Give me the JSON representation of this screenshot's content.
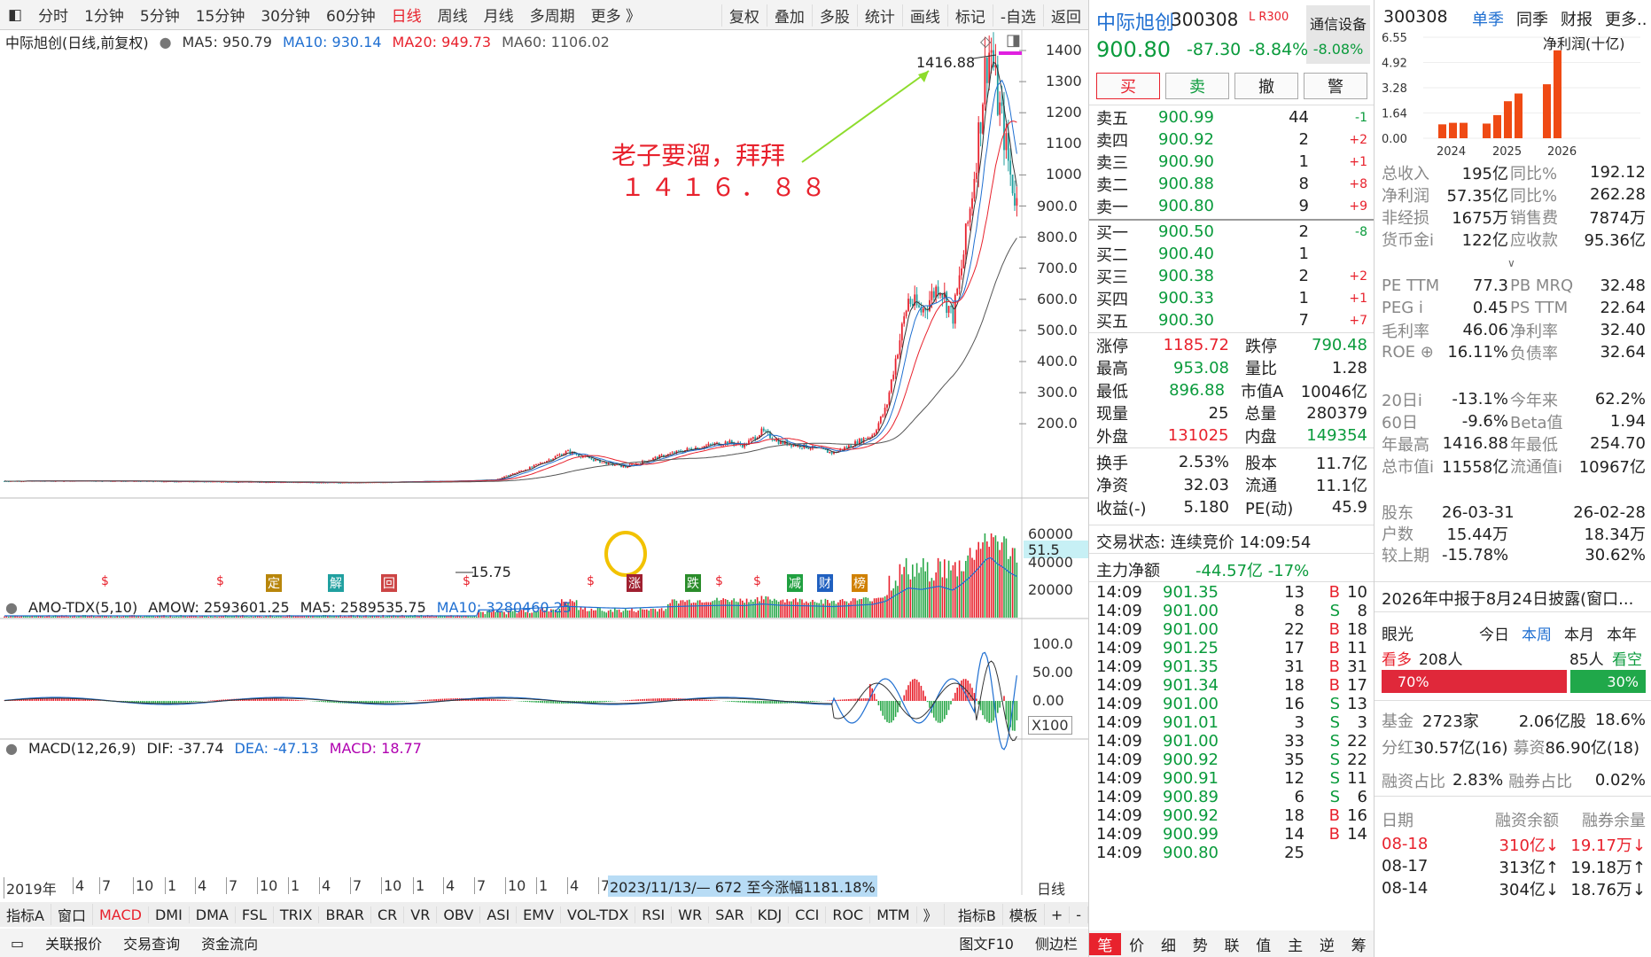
{
  "toolbar": {
    "periods": [
      "分时",
      "1分钟",
      "5分钟",
      "15分钟",
      "30分钟",
      "60分钟",
      "日线",
      "周线",
      "月线",
      "多周期",
      "更多 》"
    ],
    "active_period": "日线",
    "right": [
      "复权",
      "叠加",
      "多股",
      "统计",
      "画线",
      "标记",
      "-自选",
      "返回"
    ]
  },
  "main_info": {
    "name": "中际旭创(日线,前复权)",
    "ma5": "MA5: 950.79",
    "ma10": "MA10: 930.14",
    "ma20": "MA20: 949.73",
    "ma60": "MA60: 1106.02"
  },
  "annotation": {
    "line1": "老子要溜，拜拜",
    "line2": "１４１６．８８",
    "peak": "1416.88",
    "low": "15.75"
  },
  "price_axis": [
    "1400",
    "1300",
    "1200",
    "1100",
    "1000",
    "900.0",
    "800.0",
    "700.0",
    "600.0",
    "500.0",
    "400.0",
    "300.0",
    "200.0"
  ],
  "current_tag": "51.5",
  "vol_info": {
    "name": "AMO-TDX(5,10)",
    "amow": "AMOW: 2593601.25",
    "ma5": "MA5: 2589535.75",
    "ma10": "MA10: 3280460.25"
  },
  "vol_axis": [
    "60000",
    "40000",
    "20000"
  ],
  "vol_unit": "X100",
  "macd_info": {
    "name": "MACD(12,26,9)",
    "dif": "DIF: -37.74",
    "dea": "DEA: -47.13",
    "macd": "MACD: 18.77"
  },
  "macd_axis": [
    "100.0",
    "50.00",
    "0.00"
  ],
  "time_axis": [
    "2019年",
    "4",
    "7",
    "10",
    "1",
    "4",
    "7",
    "10",
    "1",
    "4",
    "7",
    "10",
    "1",
    "4",
    "7",
    "10",
    "1",
    "4",
    "7",
    "10",
    "1",
    "4",
    "7",
    "10",
    "1",
    "4",
    "7"
  ],
  "range_text": "2023/11/13/— 672 至今涨幅1181.18%",
  "time_unit": "日线",
  "event_marks": [
    "$",
    "$",
    "定",
    "解",
    "回",
    "$",
    "$",
    "涨",
    "跌",
    "$",
    "$",
    "减",
    "财",
    "榜"
  ],
  "indicator_tabs": [
    "指标A",
    "窗口",
    "MACD",
    "DMI",
    "DMA",
    "FSL",
    "TRIX",
    "BRAR",
    "CR",
    "VR",
    "OBV",
    "ASI",
    "EMV",
    "VOL-TDX",
    "RSI",
    "WR",
    "SAR",
    "KDJ",
    "CCI",
    "ROC",
    "MTM",
    "》",
    "指标B",
    "模板",
    "+",
    "-"
  ],
  "status_tabs": [
    "关联报价",
    "交易查询",
    "资金流向"
  ],
  "status_right": [
    "图文F10",
    "侧边栏"
  ],
  "quote": {
    "name": "中际旭创",
    "code": "300308",
    "tag": "L R300",
    "industry": "通信设备",
    "price": "900.80",
    "change": "-87.30",
    "pct": "-8.84%",
    "ind_pct": "-8.08%",
    "buttons": [
      "买",
      "卖",
      "撤",
      "警"
    ],
    "asks": [
      [
        "卖五",
        "900.99",
        "44",
        "-1"
      ],
      [
        "卖四",
        "900.92",
        "2",
        "+2"
      ],
      [
        "卖三",
        "900.90",
        "1",
        "+1"
      ],
      [
        "卖二",
        "900.88",
        "8",
        "+8"
      ],
      [
        "卖一",
        "900.80",
        "9",
        "+9"
      ]
    ],
    "bids": [
      [
        "买一",
        "900.50",
        "2",
        "-8"
      ],
      [
        "买二",
        "900.40",
        "1",
        ""
      ],
      [
        "买三",
        "900.38",
        "2",
        "+2"
      ],
      [
        "买四",
        "900.33",
        "1",
        "+1"
      ],
      [
        "买五",
        "900.30",
        "7",
        "+7"
      ]
    ],
    "stats1": [
      [
        "涨停",
        "1185.72",
        "跌停",
        "790.48"
      ],
      [
        "最高",
        "953.08",
        "量比",
        "1.28"
      ],
      [
        "最低",
        "896.88",
        "市值A",
        "10046亿"
      ],
      [
        "现量",
        "25",
        "总量",
        "280379"
      ],
      [
        "外盘",
        "131025",
        "内盘",
        "149354"
      ]
    ],
    "stats2": [
      [
        "换手",
        "2.53%",
        "股本",
        "11.7亿"
      ],
      [
        "净资",
        "32.03",
        "流通",
        "11.1亿"
      ],
      [
        "收益(-)",
        "5.180",
        "PE(动)",
        "45.9"
      ]
    ],
    "state": "交易状态: 连续竞价 14:09:54",
    "flow_label": "主力净额",
    "flow_val": "-44.57亿 -17%",
    "ticks": [
      [
        "14:09",
        "901.35",
        "13",
        "B",
        "10"
      ],
      [
        "14:09",
        "901.00",
        "8",
        "S",
        "8"
      ],
      [
        "14:09",
        "901.00",
        "22",
        "B",
        "18"
      ],
      [
        "14:09",
        "901.25",
        "17",
        "B",
        "11"
      ],
      [
        "14:09",
        "901.35",
        "31",
        "B",
        "31"
      ],
      [
        "14:09",
        "901.34",
        "18",
        "B",
        "17"
      ],
      [
        "14:09",
        "901.00",
        "16",
        "S",
        "13"
      ],
      [
        "14:09",
        "901.01",
        "3",
        "S",
        "3"
      ],
      [
        "14:09",
        "901.00",
        "33",
        "S",
        "22"
      ],
      [
        "14:09",
        "900.92",
        "35",
        "S",
        "22"
      ],
      [
        "14:09",
        "900.91",
        "12",
        "S",
        "11"
      ],
      [
        "14:09",
        "900.89",
        "6",
        "S",
        "6"
      ],
      [
        "14:09",
        "900.92",
        "18",
        "B",
        "16"
      ],
      [
        "14:09",
        "900.99",
        "14",
        "B",
        "14"
      ],
      [
        "14:09",
        "900.80",
        "25",
        "",
        ""
      ]
    ],
    "bottom_tabs": [
      "笔",
      "价",
      "细",
      "势",
      "联",
      "值",
      "主",
      "逆",
      "筹"
    ]
  },
  "fin": {
    "code": "300308",
    "tabs": [
      "单季",
      "同季",
      "财报",
      "更多.."
    ],
    "chart_title": "净利润(十亿)",
    "chart_data": {
      "type": "bar",
      "ylabel": "净利润(十亿)",
      "ylim": [
        0,
        6.55
      ],
      "y_ticks": [
        "6.55",
        "4.92",
        "3.28",
        "1.64",
        "0.00"
      ],
      "x_labels": [
        "2024",
        "2025",
        "2026"
      ],
      "values": [
        0.9,
        1.0,
        1.0,
        0.95,
        1.5,
        2.4,
        2.9,
        3.5,
        5.7
      ]
    },
    "rows1": [
      [
        "总收入",
        "195亿",
        "同比%",
        "192.12"
      ],
      [
        "净利润",
        "57.35亿",
        "同比%",
        "262.28"
      ],
      [
        "非经损",
        "1675万",
        "销售费",
        "7874万"
      ],
      [
        "货币金i",
        "122亿",
        "应收款",
        "95.36亿"
      ]
    ],
    "rows2": [
      [
        "PE TTM",
        "77.3",
        "PB MRQ",
        "32.48"
      ],
      [
        "PEG i",
        "0.45",
        "PS TTM",
        "22.64"
      ],
      [
        "毛利率",
        "46.06",
        "净利率",
        "32.40"
      ],
      [
        "ROE ⊕",
        "16.11%",
        "负债率",
        "32.64"
      ]
    ],
    "rows3": [
      [
        "20日i",
        "-13.1%",
        "今年来",
        "62.2%"
      ],
      [
        "60日",
        "-9.6%",
        "Beta值",
        "1.94"
      ],
      [
        "年最高",
        "1416.88",
        "年最低",
        "254.70"
      ],
      [
        "总市值i",
        "11558亿",
        "流通值i",
        "10967亿"
      ]
    ],
    "rows4": [
      [
        "股东",
        "26-03-31",
        "",
        "26-02-28"
      ],
      [
        "户数",
        "15.44万",
        "",
        "18.34万"
      ],
      [
        "较上期",
        "-15.78%",
        "",
        "30.62%"
      ]
    ],
    "report": "2026年中报于8月24日披露(窗口...",
    "vision_label": "眼光",
    "vision_tabs": [
      "今日",
      "本周",
      "本月",
      "本年"
    ],
    "bull": "看多",
    "bull_n": "208人",
    "bear_n": "85人",
    "bear": "看空",
    "bull_pct": "70%",
    "bear_pct": "30%",
    "fund": "基金",
    "fund_n": "2723家",
    "fund_v": "2.06亿股",
    "fund_p": "18.6%",
    "div": "分红",
    "div_v": "30.57亿(16)",
    "raise": "募资",
    "raise_v": "86.90亿(18)",
    "margin": "融资占比",
    "margin_v": "2.83%",
    "short": "融券占比",
    "short_v": "0.02%",
    "mt_head": [
      "日期",
      "融资余额",
      "融券余量"
    ],
    "mt_rows": [
      [
        "08-18",
        "310亿↓",
        "19.17万↓"
      ],
      [
        "08-17",
        "313亿↑",
        "19.18万↑"
      ],
      [
        "08-14",
        "304亿↓",
        "18.76万↓"
      ]
    ]
  }
}
